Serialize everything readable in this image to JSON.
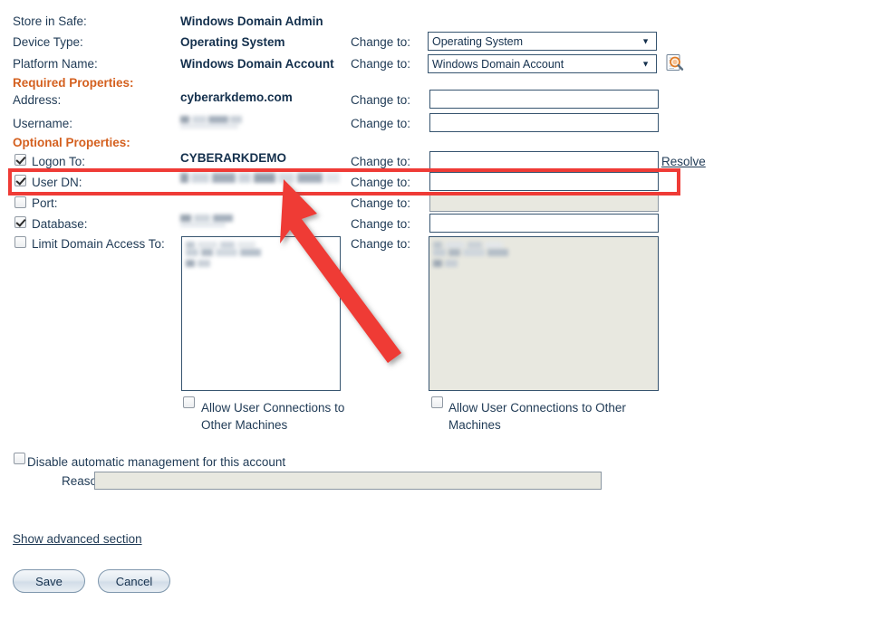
{
  "form": {
    "rows": [
      {
        "label": "Store in Safe:",
        "value": "Windows Domain Admin"
      },
      {
        "label": "Device Type:",
        "value": "Operating System",
        "change_label": "Change to:"
      },
      {
        "label": "Platform Name:",
        "value": "Windows Domain Account",
        "change_label": "Change to:"
      }
    ],
    "required_header": "Required Properties:",
    "required_rows": [
      {
        "label": "Address:",
        "value": "cyberarkdemo.com",
        "change_label": "Change to:",
        "input_value": ""
      },
      {
        "label": "Username:",
        "value": "",
        "change_label": "Change to:",
        "input_value": "",
        "redacted": true
      }
    ],
    "optional_header": "Optional Properties:",
    "optional_rows": [
      {
        "label": "Logon To:",
        "checked": true,
        "value": "CYBERARKDEMO",
        "change_label": "Change to:",
        "input_value": "",
        "disabled": false
      },
      {
        "label": "User DN:",
        "checked": true,
        "value": "",
        "change_label": "Change to:",
        "input_value": "",
        "disabled": false,
        "redacted": true
      },
      {
        "label": "Port:",
        "checked": false,
        "value": "",
        "change_label": "Change to:",
        "input_value": "",
        "disabled": true
      },
      {
        "label": "Database:",
        "checked": true,
        "value": "",
        "change_label": "Change to:",
        "input_value": "",
        "disabled": false,
        "redacted": true
      },
      {
        "label": "Limit Domain Access To:",
        "checked": false,
        "value": "",
        "change_label": "Change to:",
        "input_value": "",
        "disabled": false,
        "redacted": true
      }
    ],
    "resolve_link": "Resolve",
    "allow_conn_left": "Allow User Connections to Other Machines",
    "allow_conn_right": "Allow User Connections to Other Machines",
    "disable_mgmt_label": "Disable automatic management for this account",
    "reason_label": "Reason:",
    "reason_value": "",
    "advanced_link": "Show advanced section"
  },
  "selects": {
    "device_type": {
      "value": "Operating System",
      "caret": "▼"
    },
    "platform": {
      "value": "Windows Domain Account",
      "caret": "▼"
    }
  },
  "icons": {
    "resolve_platform": "document-search-icon",
    "caret": "▼"
  },
  "buttons": {
    "save": "Save",
    "cancel": "Cancel"
  },
  "annotation": {
    "highlight_color": "#ef3b36",
    "arrow_color": "#ef3b36",
    "target": "User DN row"
  },
  "colors": {
    "section_header": "#d4601f",
    "text": "#1f3a55",
    "value_bold": "#14304d",
    "input_border": "#36546f",
    "disabled_bg": "#e8e8e0",
    "annotation": "#ef3b36"
  }
}
